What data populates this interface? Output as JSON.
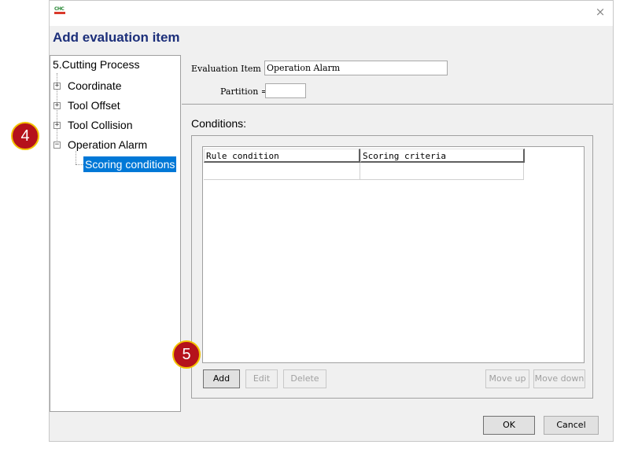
{
  "dialog": {
    "title": "Add evaluation item",
    "logo_text": "CHC",
    "close_glyph": "×"
  },
  "tree": {
    "root": "5.Cutting Process",
    "items": [
      {
        "label": "Coordinate",
        "toggle": "+"
      },
      {
        "label": "Tool Offset",
        "toggle": "+"
      },
      {
        "label": "Tool Collision",
        "toggle": "+"
      },
      {
        "label": "Operation Alarm",
        "toggle": "−"
      }
    ],
    "child": "Scoring conditions"
  },
  "form": {
    "evaluation_item_label": "Evaluation Item =",
    "evaluation_item_value": "Operation Alarm",
    "partition_label": "Partition =",
    "partition_value": ""
  },
  "conditions": {
    "label": "Conditions:",
    "columns": [
      "Rule condition",
      "Scoring criteria"
    ]
  },
  "buttons": {
    "add": "Add",
    "edit": "Edit",
    "delete": "Delete",
    "move_up": "Move up",
    "move_down": "Move down",
    "ok": "OK",
    "cancel": "Cancel"
  },
  "callouts": {
    "tree_step": "4",
    "add_step": "5"
  },
  "colors": {
    "title": "#1c2f7a",
    "selection": "#0078d7",
    "callout": "#b5121b",
    "callout_border": "#f2c200"
  }
}
